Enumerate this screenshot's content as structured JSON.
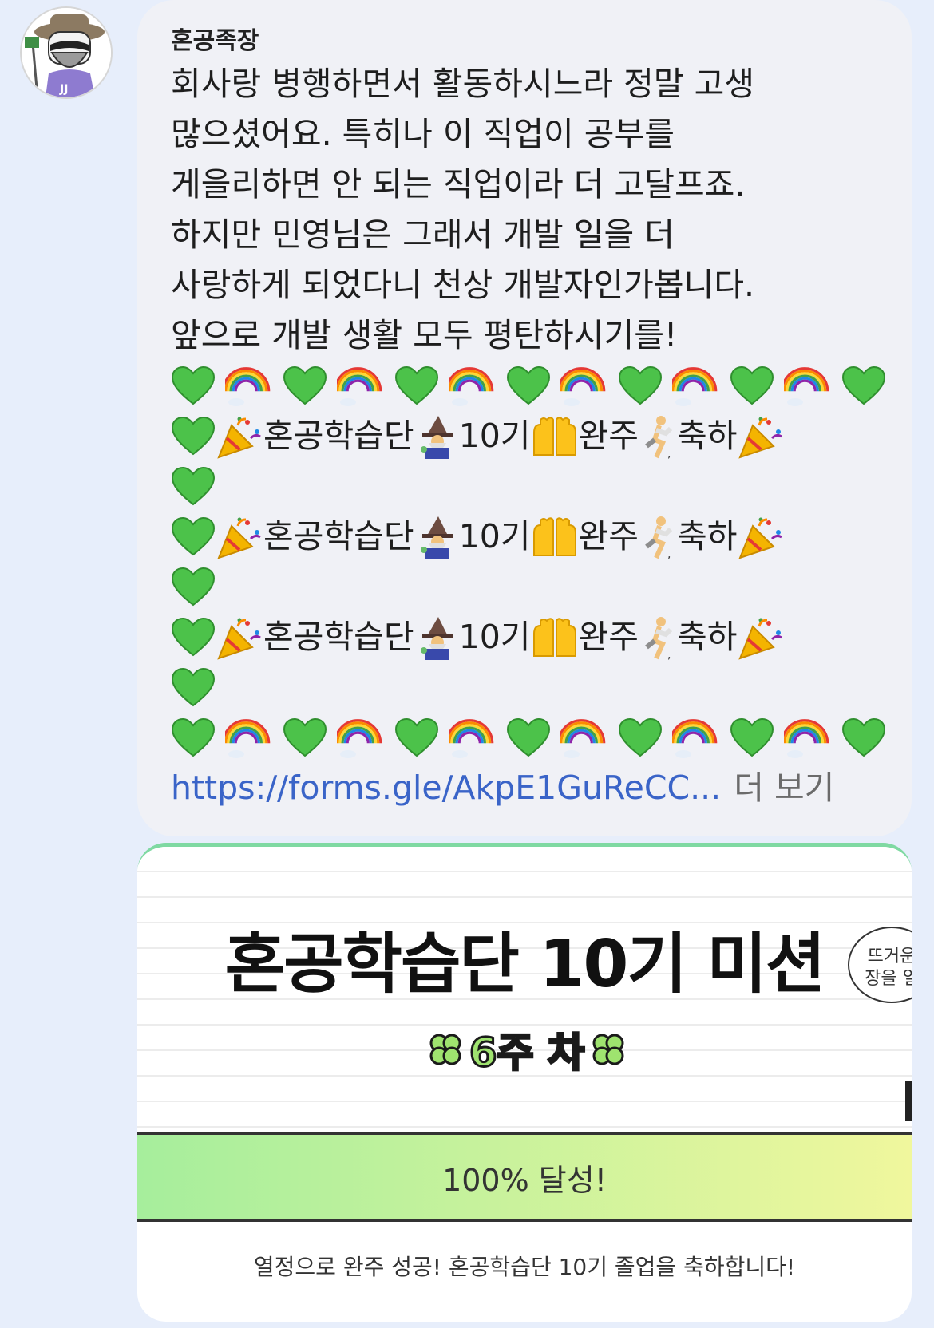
{
  "sender": {
    "name": "혼공족장",
    "avatar_label": "JJ"
  },
  "message": {
    "lines": [
      "회사랑 병행하면서 활동하시느라 정말 고생",
      "많으셨어요. 특히나 이 직업이 공부를",
      "게을리하면 안 되는 직업이라 더 고달프죠.",
      "하지만 민영님은 그래서 개발 일을 더",
      "사랑하게 되었다니 천상 개발자인가봅니다.",
      "앞으로 개발 생활 모두 평탄하시기를!"
    ],
    "celebrate": {
      "name": "혼공학습단",
      "gen": "10기",
      "finish": "완주",
      "congrats": "축하"
    },
    "link": "https://forms.gle/AkpE1GuReCC...",
    "more": "더 보기"
  },
  "card": {
    "title": "혼공학습단 10기 미션",
    "week": "6주 차",
    "speech": "뜨거운\n장을 일",
    "progress_percent": 100,
    "progress_label": "100% 달성!",
    "caption": "열정으로 완주 성공! 혼공학습단 10기 졸업을 축하합니다!"
  },
  "colors": {
    "background": "#e7eefb",
    "bubble": "#f0f1f6",
    "link": "#3a64c8",
    "heart": "#4cc24a",
    "card_accent": "#7fd9a2"
  },
  "icons": [
    "green-heart-icon",
    "rainbow-icon",
    "party-popper-icon",
    "wizard-icon",
    "raised-hands-icon",
    "runner-icon"
  ]
}
